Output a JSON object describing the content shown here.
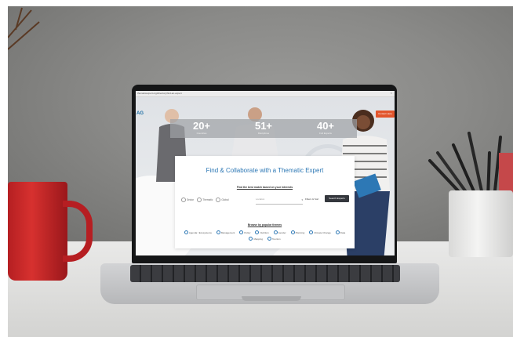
{
  "browser": {
    "url": "thematicexpert.org/directory/find-an-expert",
    "close_glyph": "×"
  },
  "site": {
    "logo": "AG",
    "cta_label": "Contact Here"
  },
  "stats": [
    {
      "value": "20+",
      "label": "Countries"
    },
    {
      "value": "51+",
      "label": "Disciplines"
    },
    {
      "value": "40+",
      "label": "Full Experts"
    }
  ],
  "search_card": {
    "title": "Find & Collaborate with a Thematic Expert",
    "subtitle": "Find the best match based on your interests",
    "radio_options": [
      "Sector",
      "Thematic",
      "Global"
    ],
    "select_placeholder": "Location",
    "select_chevron": "▾",
    "filter_label": "Filters & Sort",
    "search_button": "Search Experts",
    "browse_heading": "Browse by popular themes",
    "themes": [
      "Agenda / Ecosystems",
      "Management",
      "Policy",
      "Nutrition",
      "Gender",
      "Planning",
      "Climate Change",
      "Data",
      "Mapping",
      "Tourism"
    ]
  },
  "colors": {
    "accent": "#2d78b5",
    "cta": "#e2552c",
    "button_dark": "#34373d"
  }
}
